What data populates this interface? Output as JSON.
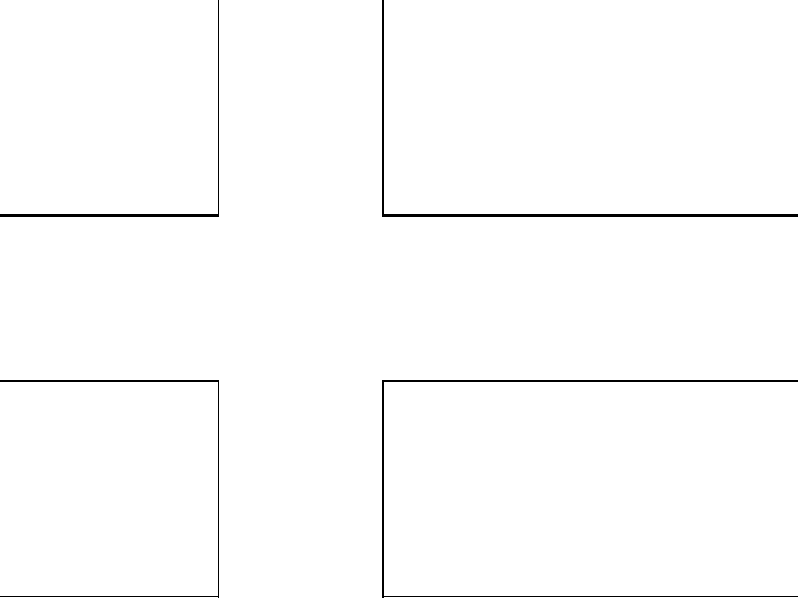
{
  "scene": {
    "description_text": "",
    "colors": {
      "background": "#ffffff",
      "stroke": "#000000"
    },
    "blocks": [
      "upper-left",
      "upper-right",
      "lower-left",
      "lower-right"
    ]
  }
}
